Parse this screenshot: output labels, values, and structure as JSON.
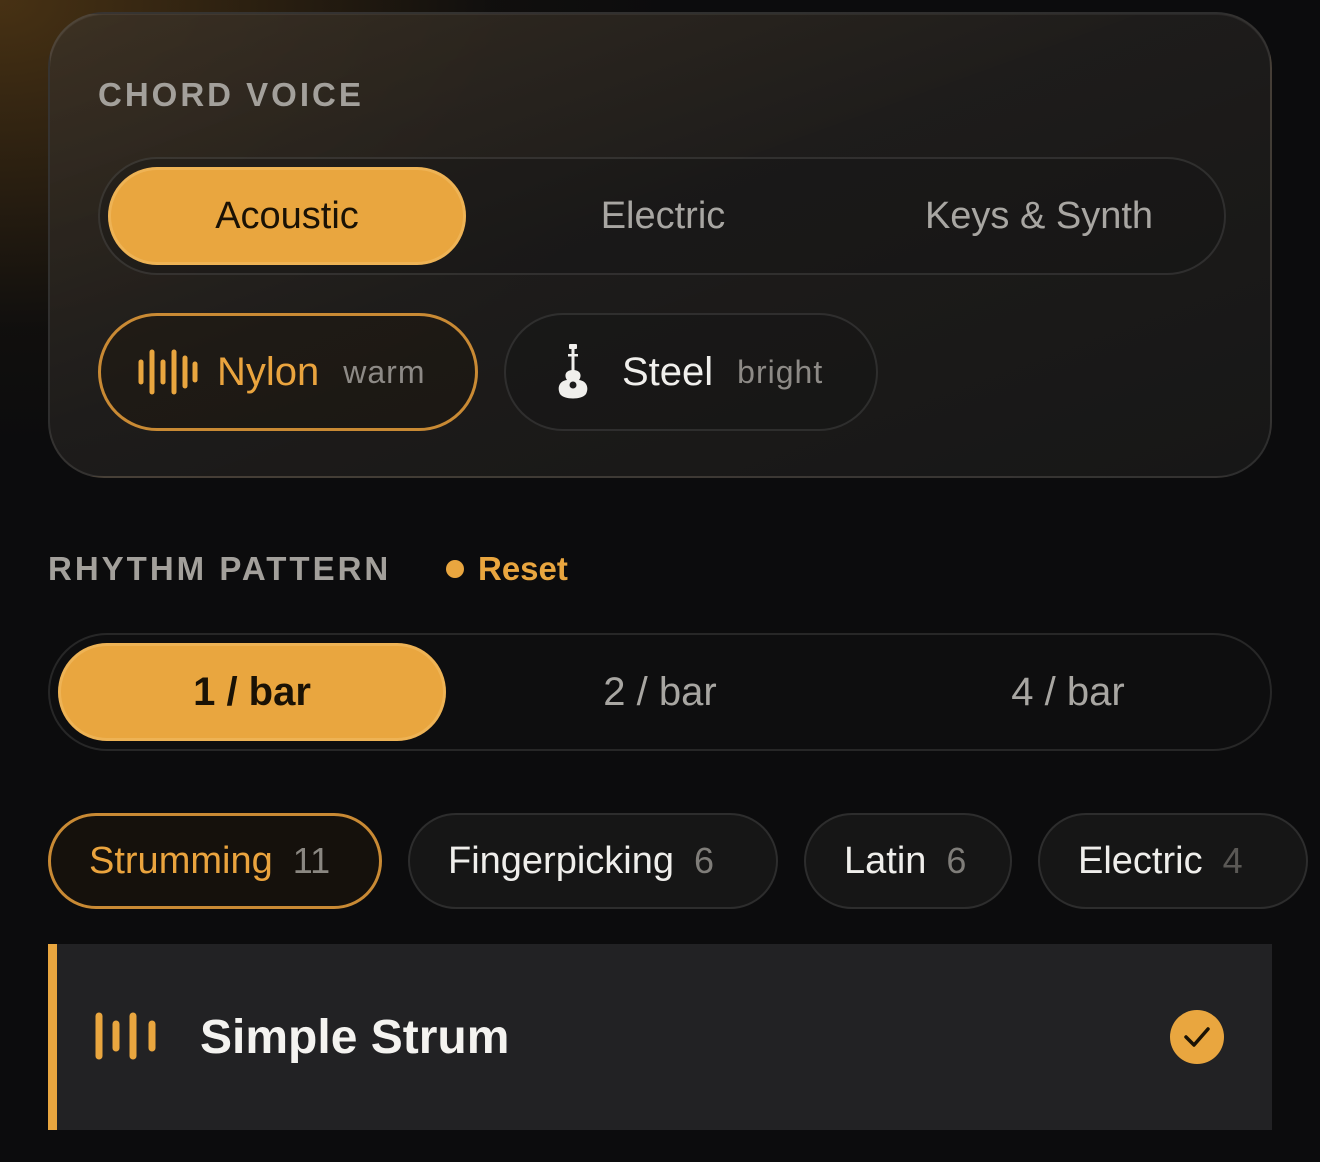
{
  "chord_voice": {
    "label": "CHORD VOICE",
    "tabs": [
      {
        "label": "Acoustic",
        "active": true
      },
      {
        "label": "Electric",
        "active": false
      },
      {
        "label": "Keys & Synth",
        "active": false
      }
    ],
    "variants": [
      {
        "name": "Nylon",
        "sub": "warm",
        "icon": "waveform-icon",
        "active": true
      },
      {
        "name": "Steel",
        "sub": "bright",
        "icon": "guitar-icon",
        "active": false
      }
    ]
  },
  "rhythm_pattern": {
    "label": "RHYTHM PATTERN",
    "reset_label": "Reset",
    "density": [
      {
        "label": "1 / bar",
        "active": true
      },
      {
        "label": "2 / bar",
        "active": false
      },
      {
        "label": "4 / bar",
        "active": false
      }
    ],
    "categories": [
      {
        "label": "Strumming",
        "count": "11",
        "active": true
      },
      {
        "label": "Fingerpicking",
        "count": "6",
        "active": false
      },
      {
        "label": "Latin",
        "count": "6",
        "active": false
      },
      {
        "label": "Electric",
        "count": "4",
        "active": false
      }
    ]
  },
  "patterns": [
    {
      "title": "Simple Strum",
      "icon": "waveform-icon",
      "selected": true
    }
  ],
  "colors": {
    "accent": "#e9a63f",
    "background": "#0c0c0d",
    "row_background": "#222224"
  }
}
